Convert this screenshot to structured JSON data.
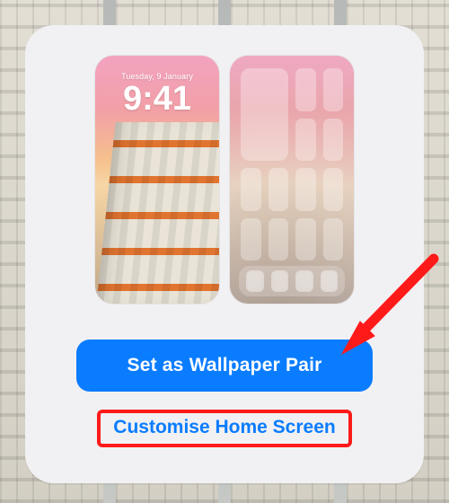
{
  "lock_preview": {
    "date": "Tuesday, 9 January",
    "time": "9:41"
  },
  "buttons": {
    "set_pair": "Set as Wallpaper Pair",
    "customise": "Customise Home Screen"
  },
  "colors": {
    "primary": "#0a7cff",
    "annotation": "#ff1a1a"
  }
}
